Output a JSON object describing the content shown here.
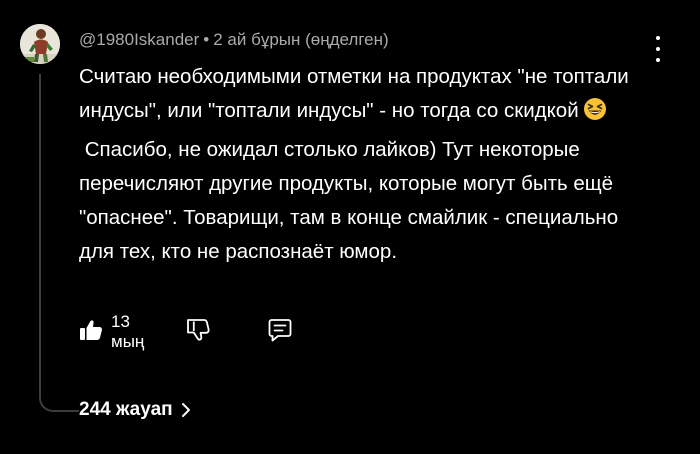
{
  "comment": {
    "author": "@1980Iskander",
    "separator": "•",
    "time": "2 ай бұрын (өңделген)",
    "paragraph_1": "Считаю необходимыми отметки на продуктах \"не топтали индусы\", или \"топтали индусы\" - но тогда со скидкой",
    "paragraph_2": "Спасибо, не ожидал столько лайков) Тут некоторые перечисляют другие продукты, которые могут быть ещё \"опаснее\". Товарищи, там в конце смайлик - специально для тех, кто не распознаёт юмор.",
    "emoji_icon": "grinning-squinting-face-icon",
    "likes": "13 мың"
  },
  "replies": {
    "label": "244 жауап"
  },
  "colors": {
    "background": "#000000",
    "text": "#ffffff",
    "meta": "#aaaaaa",
    "thread_line": "#3d3d3d"
  }
}
